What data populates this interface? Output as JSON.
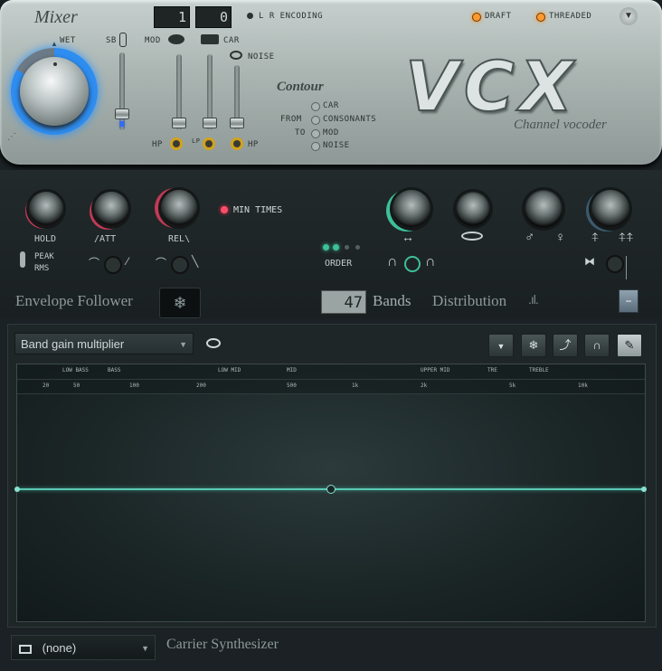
{
  "mixer": {
    "title": "Mixer",
    "wet_label": "WET",
    "sb_label": "SB",
    "mod_label": "MOD",
    "car_label": "CAR",
    "noise_label": "NOISE",
    "hp_label": "HP",
    "lp_label": "LP",
    "hp2_label": "HP"
  },
  "header": {
    "lcd_left": "1",
    "lcd_right": "0",
    "lr_encoding": "L R ENCODING",
    "draft_label": "DRAFT",
    "threaded_label": "THREADED"
  },
  "contour": {
    "title": "Contour",
    "from_label": "FROM",
    "to_label": "TO",
    "options": [
      "CAR",
      "CONSONANTS",
      "MOD",
      "NOISE"
    ]
  },
  "logo": {
    "text": "VCX",
    "subtitle": "Channel vocoder"
  },
  "envelope": {
    "hold_label": "HOLD",
    "att_label": "ATT",
    "rel_label": "REL",
    "min_times_label": "MIN TIMES",
    "peak_label": "PEAK",
    "rms_label": "RMS",
    "order_label": "ORDER",
    "section_title": "Envelope Follower"
  },
  "bands": {
    "count": "47",
    "label": "Bands",
    "distribution_label": "Distribution"
  },
  "graph": {
    "selector_value": "Band gain multiplier",
    "ruler_top": [
      "LOW BASS",
      "BASS",
      "LOW MID",
      "MID",
      "UPPER MID",
      "TRE",
      "TREBLE"
    ],
    "ruler_bottom": [
      "20",
      "50",
      "100",
      "200",
      "500",
      "1k",
      "2k",
      "5k",
      "10k"
    ]
  },
  "footer": {
    "carrier_value": "(none)",
    "carrier_label": "Carrier Synthesizer"
  },
  "colors": {
    "accent_green": "#3dbf9a",
    "accent_pink": "#d2455f",
    "accent_blue": "#2e8df0",
    "led_orange": "#ff9a2e",
    "curve": "#5cc9b4"
  }
}
